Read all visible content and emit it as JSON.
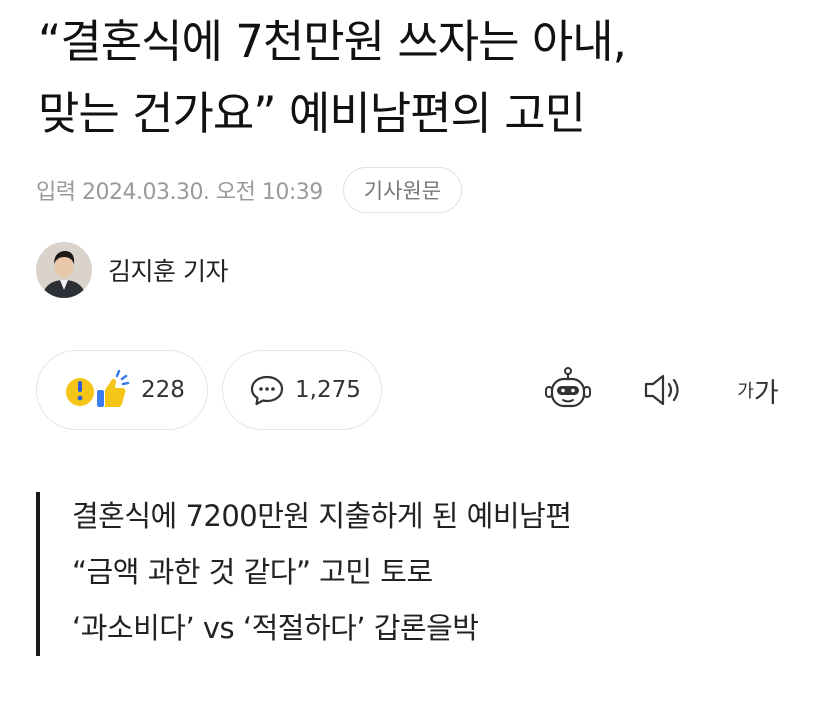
{
  "article": {
    "title_line1": "“결혼식에 7천만원 쓰자는 아내,",
    "title_line2": "맞는 건가요” 예비남편의 고민",
    "date": "입력 2024.03.30. 오전 10:39",
    "origin_button": "기사원문",
    "author": "김지훈 기자"
  },
  "reactions": {
    "reaction_count": "228",
    "comment_count": "1,275",
    "icons": [
      "surprise-emoji-icon",
      "thumbs-up-icon",
      "comment-bubble-icon",
      "summary-bot-icon",
      "speaker-icon"
    ]
  },
  "toolbar": {
    "font_small": "가",
    "font_big": "가"
  },
  "summary": {
    "lines": [
      "결혼식에 7200만원 지출하게 된 예비남편",
      "“금액 과한 것 같다” 고민 토로",
      "‘과소비다’ vs ‘적절하다’ 갑론을박"
    ]
  },
  "colors": {
    "accent_yellow": "#F5C518",
    "accent_blue": "#3D7BF0",
    "text_gray": "#9A9A9A"
  }
}
